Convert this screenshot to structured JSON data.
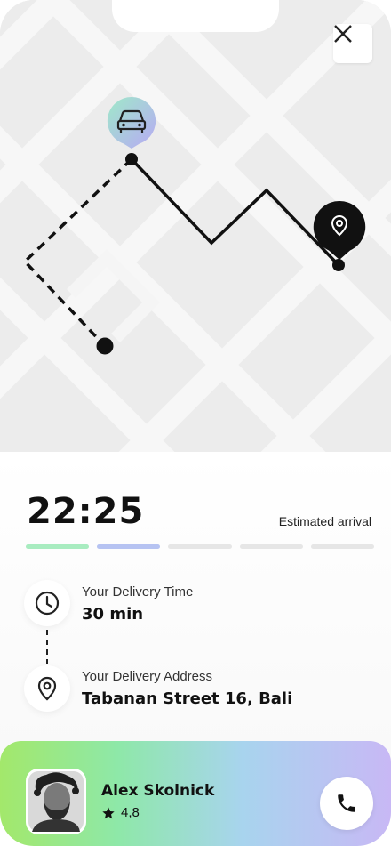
{
  "map": {
    "close_icon": "close-icon",
    "car_icon": "car-icon",
    "destination_icon": "location-pin-icon"
  },
  "eta": {
    "time": "22:25",
    "label": "Estimated arrival",
    "progress": {
      "total_steps": 5,
      "completed_steps": 2,
      "colors": [
        "#a8ecc0",
        "#b6c3f2",
        "#e6e6e6",
        "#e6e6e6",
        "#e6e6e6"
      ]
    }
  },
  "delivery": {
    "time_label": "Your Delivery Time",
    "time_value": "30 min",
    "address_label": "Your Delivery Address",
    "address_value": "Tabanan Street 16, Bali"
  },
  "driver": {
    "name": "Alex Skolnick",
    "rating": "4,8",
    "call_icon": "phone-icon"
  }
}
